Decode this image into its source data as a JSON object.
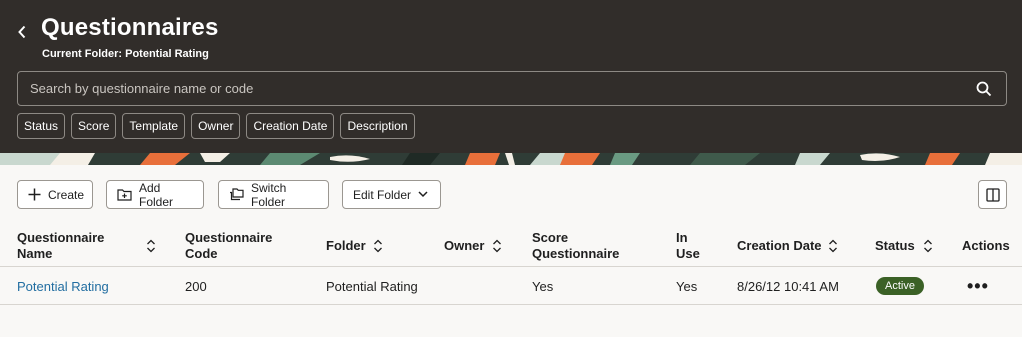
{
  "header": {
    "title": "Questionnaires",
    "subtitle": "Current Folder: Potential Rating"
  },
  "search": {
    "placeholder": "Search by questionnaire name or code"
  },
  "filters": [
    "Status",
    "Score",
    "Template",
    "Owner",
    "Creation Date",
    "Description"
  ],
  "toolbar": {
    "create": "Create",
    "add_folder": "Add Folder",
    "switch_folder": "Switch Folder",
    "edit_folder": "Edit Folder"
  },
  "table": {
    "columns": {
      "name_line1": "Questionnaire",
      "name_line2": "Name",
      "code_line1": "Questionnaire",
      "code_line2": "Code",
      "folder": "Folder",
      "owner": "Owner",
      "score_line1": "Score",
      "score_line2": "Questionnaire",
      "inuse_line1": "In",
      "inuse_line2": "Use",
      "creation_date": "Creation Date",
      "status": "Status",
      "actions": "Actions"
    },
    "rows": [
      {
        "name": "Potential Rating",
        "code": "200",
        "folder": "Potential Rating",
        "owner": "",
        "score": "Yes",
        "in_use": "Yes",
        "creation_date": "8/26/12 10:41 AM",
        "status": "Active",
        "actions": "•••"
      }
    ]
  },
  "colors": {
    "header_bg": "#312d2a",
    "link": "#226ea1",
    "status_active": "#3b6126"
  }
}
